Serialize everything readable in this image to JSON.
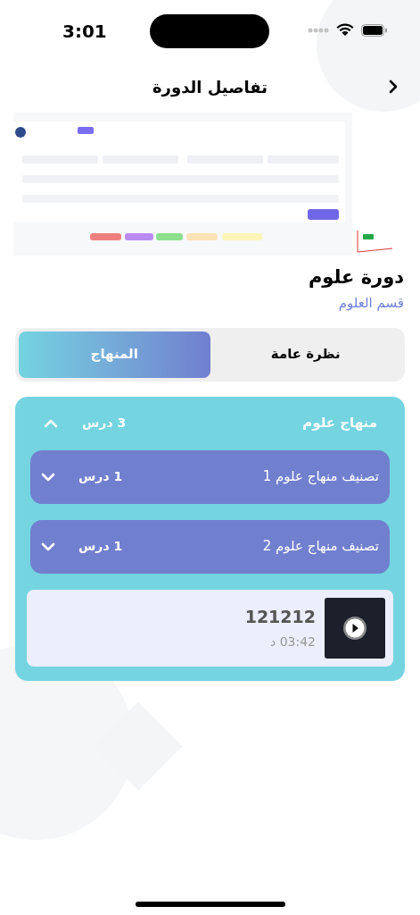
{
  "status_bar": {
    "time": "3:01"
  },
  "header": {
    "title": "تفاصيل الدورة"
  },
  "course": {
    "title": "دورة علوم",
    "department": "قسم العلوم"
  },
  "tabs": [
    {
      "label": "نظرة عامة",
      "selected": false
    },
    {
      "label": "المنهاج",
      "selected": true
    }
  ],
  "curriculum": {
    "title": "منهاج علوم",
    "count": "3 درس",
    "expanded": true,
    "sections": [
      {
        "title": "تصنيف منهاج علوم 1",
        "count": "1 درس",
        "expanded": false
      },
      {
        "title": "تصنيف منهاج علوم 2",
        "count": "1 درس",
        "expanded": false
      }
    ],
    "lessons": [
      {
        "title": "121212",
        "duration": "03:42 د"
      }
    ]
  }
}
